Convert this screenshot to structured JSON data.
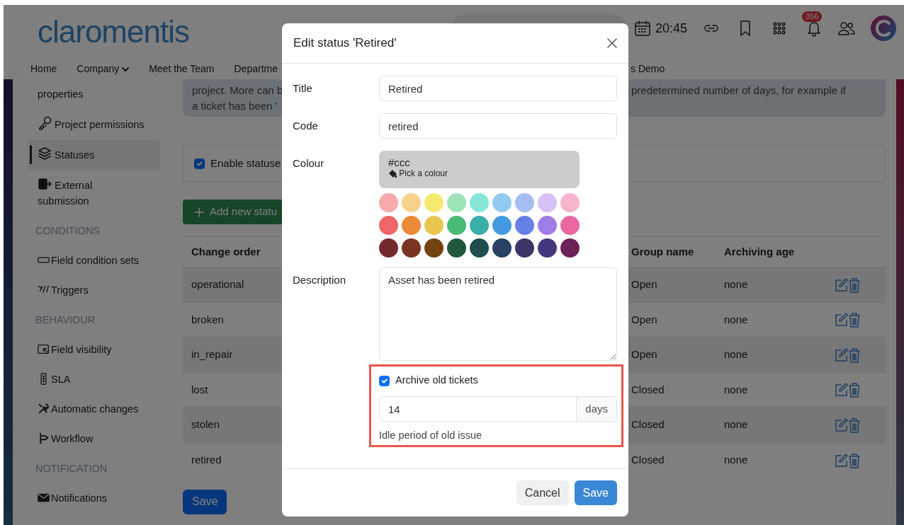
{
  "header": {
    "logo": "claromentis",
    "clock": "20:45",
    "notification_count": "356"
  },
  "nav_left": [
    {
      "label": "Home",
      "dropdown": false
    },
    {
      "label": "Company",
      "dropdown": true
    },
    {
      "label": "Meet the Team",
      "dropdown": false
    },
    {
      "label": "Departme",
      "dropdown": false
    }
  ],
  "nav_right": [
    {
      "label": "s Demo",
      "dropdown": false
    }
  ],
  "sidebar": {
    "items": [
      {
        "kind": "item",
        "label": "properties",
        "selected": false
      },
      {
        "kind": "item",
        "label": "Project permissions",
        "selected": false
      },
      {
        "kind": "item",
        "label": "Statuses",
        "selected": true
      },
      {
        "kind": "item",
        "label": "External submission",
        "selected": false
      },
      {
        "kind": "heading",
        "label": "CONDITIONS"
      },
      {
        "kind": "item",
        "label": "Field condition sets",
        "selected": false
      },
      {
        "kind": "item",
        "label": "Triggers",
        "selected": false
      },
      {
        "kind": "heading",
        "label": "BEHAVIOUR"
      },
      {
        "kind": "item",
        "label": "Field visibility",
        "selected": false
      },
      {
        "kind": "item",
        "label": "SLA",
        "selected": false
      },
      {
        "kind": "item",
        "label": "Automatic changes",
        "selected": false
      },
      {
        "kind": "item",
        "label": "Workflow",
        "selected": false
      },
      {
        "kind": "heading",
        "label": "NOTIFICATION"
      },
      {
        "kind": "item",
        "label": "Notifications",
        "selected": false
      }
    ]
  },
  "main": {
    "alert": {
      "left_lines": [
        "project. More can b",
        "a ticket has been '"
      ],
      "right_lines": [
        "predetermined number of days, for example if"
      ]
    },
    "enable_checkbox": {
      "label": "Enable statuse",
      "checked": true
    },
    "add_button": "Add new statu",
    "table": {
      "columns": [
        "Change order",
        "Group name",
        "Archiving age"
      ],
      "rows": [
        {
          "cells": [
            "operational",
            "Open",
            "none"
          ]
        },
        {
          "cells": [
            "broken",
            "Open",
            "none"
          ]
        },
        {
          "cells": [
            "in_repair",
            "Open",
            "none"
          ]
        },
        {
          "cells": [
            "lost",
            "Closed",
            "none"
          ]
        },
        {
          "cells": [
            "stolen",
            "Closed",
            "none"
          ]
        },
        {
          "cells": [
            "retired",
            "Closed",
            "none"
          ]
        }
      ]
    },
    "save_button": "Save"
  },
  "modal": {
    "title": "Edit status 'Retired'",
    "fields": [
      {
        "label": "Title",
        "value": "Retired"
      },
      {
        "label": "Code",
        "value": "retired"
      }
    ],
    "colour": {
      "label": "Colour",
      "value": "#ccc",
      "color": "#cccccc",
      "hint": "Pick a colour",
      "swatches": [
        {
          "color": "#f9a8ab"
        },
        {
          "color": "#f8d18d"
        },
        {
          "color": "#f5ea6f"
        },
        {
          "color": "#9ee3b6"
        },
        {
          "color": "#86e6d8"
        },
        {
          "color": "#93cbf0"
        },
        {
          "color": "#a4bef4"
        },
        {
          "color": "#d7c0f6"
        },
        {
          "color": "#f8b4cc"
        },
        {
          "color": "#ef6667"
        },
        {
          "color": "#ec8a37"
        },
        {
          "color": "#e8c54f"
        },
        {
          "color": "#48b976"
        },
        {
          "color": "#3aafa8"
        },
        {
          "color": "#449ae0"
        },
        {
          "color": "#6681e6"
        },
        {
          "color": "#a07ce6"
        },
        {
          "color": "#eb67a2"
        },
        {
          "color": "#722a2c"
        },
        {
          "color": "#7b3420"
        },
        {
          "color": "#724210"
        },
        {
          "color": "#21573c"
        },
        {
          "color": "#204e4e"
        },
        {
          "color": "#2a3f63"
        },
        {
          "color": "#3b3465"
        },
        {
          "color": "#45357a"
        },
        {
          "color": "#6b2355"
        }
      ]
    },
    "description": {
      "label": "Description",
      "value": "Asset has been retired"
    },
    "archive": {
      "label": "Archive old tickets",
      "checked": true,
      "value": "14",
      "unit": "days",
      "help": "Idle period of old issue"
    },
    "buttons": [
      {
        "label": "Cancel",
        "kind": "secondary"
      },
      {
        "label": "Save",
        "kind": "primary"
      }
    ]
  }
}
